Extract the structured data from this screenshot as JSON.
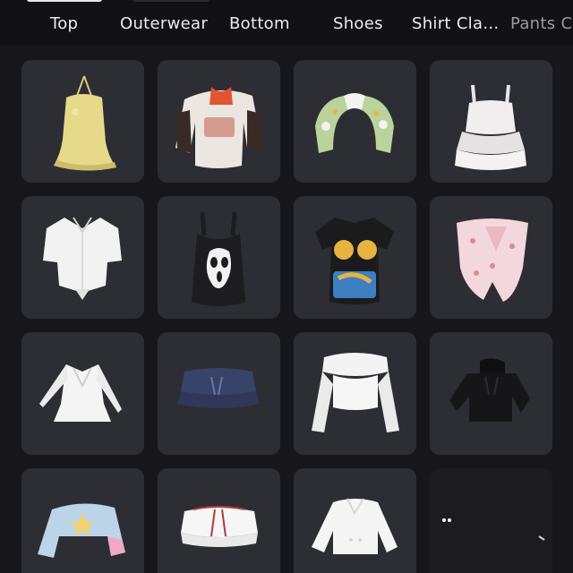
{
  "tabs": [
    {
      "label": "Top",
      "active": true
    },
    {
      "label": "Outerwear"
    },
    {
      "label": "Bottom"
    },
    {
      "label": "Shoes"
    },
    {
      "label": "Shirt Cla..."
    },
    {
      "label": "Pants C"
    }
  ],
  "items": [
    {
      "icon": "yellow-halter-top-icon",
      "color": "#e6d98a"
    },
    {
      "icon": "graphic-off-shoulder-top-icon",
      "color": "#ebe6df"
    },
    {
      "icon": "green-floral-shrug-icon",
      "color": "#b9d39a"
    },
    {
      "icon": "white-ruffle-cami-icon",
      "color": "#f0eeee"
    },
    {
      "icon": "white-tied-shirt-icon",
      "color": "#f2f2f2"
    },
    {
      "icon": "ghostface-tank-top-icon",
      "color": "#1d1d1f"
    },
    {
      "icon": "black-graphic-tee-icon",
      "color": "#1b1b1d"
    },
    {
      "icon": "pink-floral-tube-top-icon",
      "color": "#f2d7dc"
    },
    {
      "icon": "white-peplum-blouse-icon",
      "color": "#f4f4f4"
    },
    {
      "icon": "navy-ruffle-skirt-icon",
      "color": "#38436a"
    },
    {
      "icon": "white-off-shoulder-top-icon",
      "color": "#f3f3f3"
    },
    {
      "icon": "black-hoodie-icon",
      "color": "#161618"
    },
    {
      "icon": "pastel-star-crop-sweater-icon",
      "color": "#bcd4e8"
    },
    {
      "icon": "white-ruffle-bandeau-icon",
      "color": "#f6f6f6"
    },
    {
      "icon": "white-crop-jacket-icon",
      "color": "#f5f5f5"
    },
    {
      "icon": "dark-hidden-item-icon",
      "color": "#1c1c20"
    }
  ]
}
